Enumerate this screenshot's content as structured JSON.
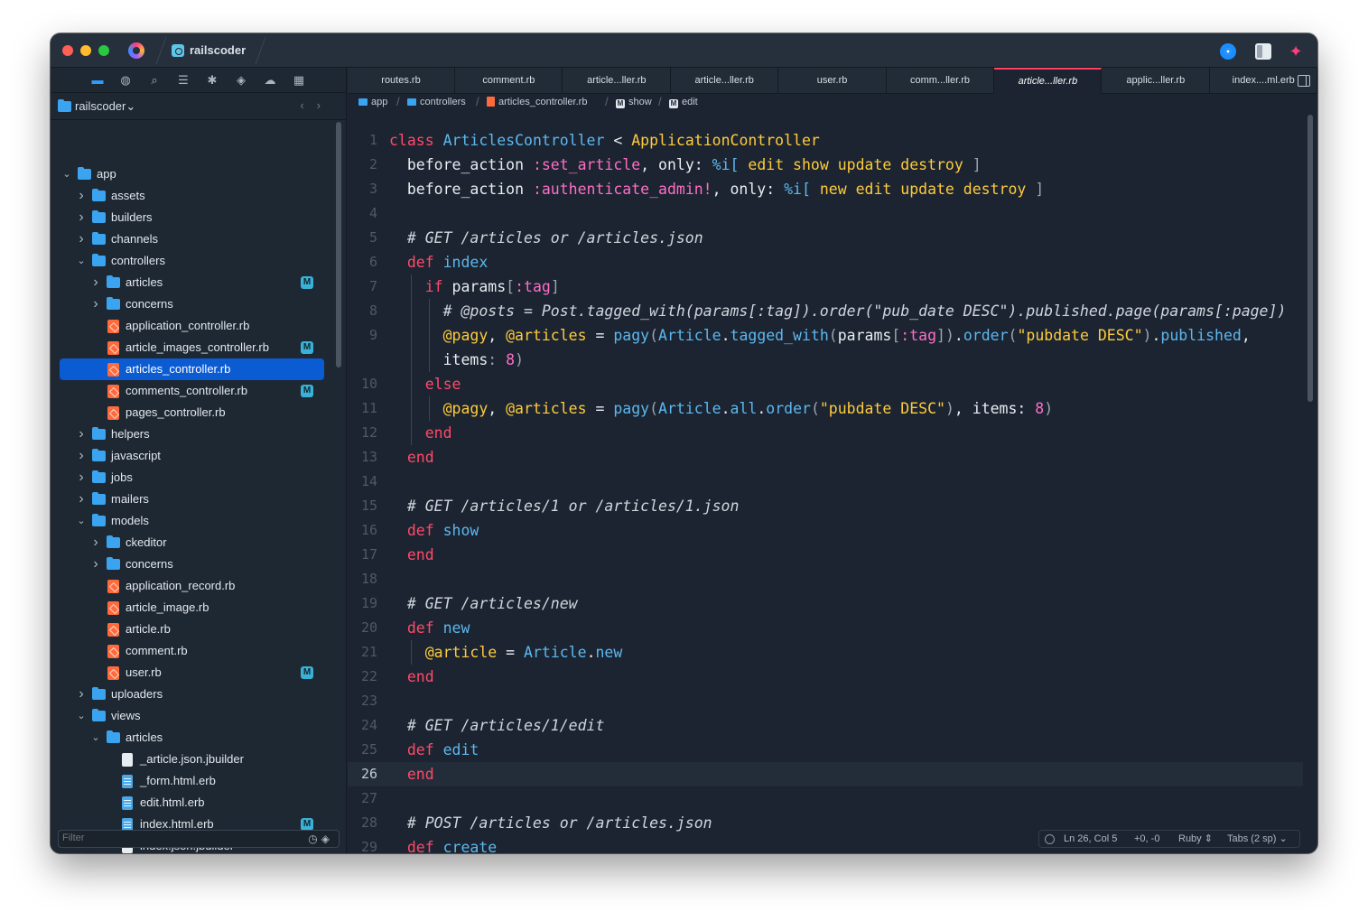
{
  "titlebar": {
    "project_name": "railscoder"
  },
  "sidebar": {
    "toolbar_icons": [
      "folder-icon",
      "globe-icon",
      "search-icon",
      "list-icon",
      "asterisk-icon",
      "git-icon",
      "cloud-icon",
      "grid-icon"
    ],
    "root_title": "railscoder",
    "filter_placeholder": "Filter",
    "tree": [
      {
        "label": "app",
        "type": "folder",
        "depth": 0,
        "expanded": true,
        "modified": false,
        "selected": false
      },
      {
        "label": "assets",
        "type": "folder",
        "depth": 1,
        "expanded": false,
        "modified": false,
        "selected": false
      },
      {
        "label": "builders",
        "type": "folder",
        "depth": 1,
        "expanded": false,
        "modified": false,
        "selected": false
      },
      {
        "label": "channels",
        "type": "folder",
        "depth": 1,
        "expanded": false,
        "modified": false,
        "selected": false
      },
      {
        "label": "controllers",
        "type": "folder",
        "depth": 1,
        "expanded": true,
        "modified": false,
        "selected": false
      },
      {
        "label": "articles",
        "type": "folder",
        "depth": 2,
        "expanded": false,
        "modified": true,
        "selected": false
      },
      {
        "label": "concerns",
        "type": "folder",
        "depth": 2,
        "expanded": false,
        "modified": false,
        "selected": false
      },
      {
        "label": "application_controller.rb",
        "type": "rb",
        "depth": 2,
        "modified": false,
        "selected": false
      },
      {
        "label": "article_images_controller.rb",
        "type": "rb",
        "depth": 2,
        "modified": true,
        "selected": false
      },
      {
        "label": "articles_controller.rb",
        "type": "rb",
        "depth": 2,
        "modified": false,
        "selected": true
      },
      {
        "label": "comments_controller.rb",
        "type": "rb",
        "depth": 2,
        "modified": true,
        "selected": false
      },
      {
        "label": "pages_controller.rb",
        "type": "rb",
        "depth": 2,
        "modified": false,
        "selected": false
      },
      {
        "label": "helpers",
        "type": "folder",
        "depth": 1,
        "expanded": false,
        "modified": false,
        "selected": false
      },
      {
        "label": "javascript",
        "type": "folder",
        "depth": 1,
        "expanded": false,
        "modified": false,
        "selected": false
      },
      {
        "label": "jobs",
        "type": "folder",
        "depth": 1,
        "expanded": false,
        "modified": false,
        "selected": false
      },
      {
        "label": "mailers",
        "type": "folder",
        "depth": 1,
        "expanded": false,
        "modified": false,
        "selected": false
      },
      {
        "label": "models",
        "type": "folder",
        "depth": 1,
        "expanded": true,
        "modified": false,
        "selected": false
      },
      {
        "label": "ckeditor",
        "type": "folder",
        "depth": 2,
        "expanded": false,
        "modified": false,
        "selected": false
      },
      {
        "label": "concerns",
        "type": "folder",
        "depth": 2,
        "expanded": false,
        "modified": false,
        "selected": false
      },
      {
        "label": "application_record.rb",
        "type": "rb",
        "depth": 2,
        "modified": false,
        "selected": false
      },
      {
        "label": "article_image.rb",
        "type": "rb",
        "depth": 2,
        "modified": false,
        "selected": false
      },
      {
        "label": "article.rb",
        "type": "rb",
        "depth": 2,
        "modified": false,
        "selected": false
      },
      {
        "label": "comment.rb",
        "type": "rb",
        "depth": 2,
        "modified": false,
        "selected": false
      },
      {
        "label": "user.rb",
        "type": "rb",
        "depth": 2,
        "modified": true,
        "selected": false
      },
      {
        "label": "uploaders",
        "type": "folder",
        "depth": 1,
        "expanded": false,
        "modified": false,
        "selected": false
      },
      {
        "label": "views",
        "type": "folder",
        "depth": 1,
        "expanded": true,
        "modified": false,
        "selected": false
      },
      {
        "label": "articles",
        "type": "folder",
        "depth": 2,
        "expanded": true,
        "modified": false,
        "selected": false
      },
      {
        "label": "_article.json.jbuilder",
        "type": "doc",
        "depth": 3,
        "modified": false,
        "selected": false
      },
      {
        "label": "_form.html.erb",
        "type": "erb",
        "depth": 3,
        "modified": false,
        "selected": false
      },
      {
        "label": "edit.html.erb",
        "type": "erb",
        "depth": 3,
        "modified": false,
        "selected": false
      },
      {
        "label": "index.html.erb",
        "type": "erb",
        "depth": 3,
        "modified": true,
        "selected": false
      },
      {
        "label": "index.json.jbuilder",
        "type": "doc",
        "depth": 3,
        "modified": false,
        "selected": false
      }
    ],
    "modified_badge": "M"
  },
  "tabs": [
    {
      "label": "routes.rb",
      "active": false
    },
    {
      "label": "comment.rb",
      "active": false
    },
    {
      "label": "article...ller.rb",
      "active": false
    },
    {
      "label": "article...ller.rb",
      "active": false
    },
    {
      "label": "user.rb",
      "active": false
    },
    {
      "label": "comm...ller.rb",
      "active": false
    },
    {
      "label": "article...ller.rb",
      "active": true
    },
    {
      "label": "applic...ller.rb",
      "active": false
    },
    {
      "label": "index....ml.erb",
      "active": false
    }
  ],
  "pathbar": [
    {
      "label": "app",
      "icon": "folder"
    },
    {
      "label": "controllers",
      "icon": "folder"
    },
    {
      "label": "articles_controller.rb",
      "icon": "rb"
    },
    {
      "label": "show",
      "icon": "method"
    },
    {
      "label": "edit",
      "icon": "method"
    }
  ],
  "editor": {
    "current_line": 26,
    "lines": [
      {
        "n": "1",
        "indent": 0,
        "t": [
          [
            "kw",
            "class"
          ],
          [
            "pl",
            " "
          ],
          [
            "cls",
            "ArticlesController"
          ],
          [
            "pl",
            " < "
          ],
          [
            "sup",
            "ApplicationController"
          ]
        ]
      },
      {
        "n": "2",
        "indent": 1,
        "t": [
          [
            "pl",
            "before_action "
          ],
          [
            "sym",
            ":set_article"
          ],
          [
            "pl",
            ", only: "
          ],
          [
            "pct",
            "%i["
          ],
          [
            "pl",
            " "
          ],
          [
            "wrd",
            "edit show update destroy"
          ],
          [
            "pl",
            " "
          ],
          [
            "dim",
            "]"
          ]
        ]
      },
      {
        "n": "3",
        "indent": 1,
        "t": [
          [
            "pl",
            "before_action "
          ],
          [
            "sym",
            ":authenticate_admin!"
          ],
          [
            "pl",
            ", only: "
          ],
          [
            "pct",
            "%i["
          ],
          [
            "pl",
            " "
          ],
          [
            "wrd",
            "new edit update destroy"
          ],
          [
            "pl",
            " "
          ],
          [
            "dim",
            "]"
          ]
        ]
      },
      {
        "n": "4",
        "indent": 0,
        "t": []
      },
      {
        "n": "5",
        "indent": 1,
        "t": [
          [
            "cmt",
            "# GET /articles or /articles.json"
          ]
        ]
      },
      {
        "n": "6",
        "indent": 1,
        "t": [
          [
            "kw",
            "def"
          ],
          [
            "pl",
            " "
          ],
          [
            "mth",
            "index"
          ]
        ]
      },
      {
        "n": "7",
        "indent": 2,
        "t": [
          [
            "kw",
            "if"
          ],
          [
            "pl",
            " params"
          ],
          [
            "dim",
            "["
          ],
          [
            "sym",
            ":tag"
          ],
          [
            "dim",
            "]"
          ]
        ]
      },
      {
        "n": "8",
        "indent": 3,
        "t": [
          [
            "cmt",
            "# @posts = Post.tagged_with(params[:tag]).order(\"pub_date DESC\").published.page(params[:page])"
          ]
        ]
      },
      {
        "n": "9",
        "indent": 3,
        "t": [
          [
            "ivar",
            "@pagy"
          ],
          [
            "pl",
            ", "
          ],
          [
            "ivar",
            "@articles"
          ],
          [
            "pl",
            " = "
          ],
          [
            "mth",
            "pagy"
          ],
          [
            "dim",
            "("
          ],
          [
            "cls",
            "Article"
          ],
          [
            "pl",
            "."
          ],
          [
            "mth",
            "tagged_with"
          ],
          [
            "dim",
            "("
          ],
          [
            "pl",
            "params"
          ],
          [
            "dim",
            "["
          ],
          [
            "sym",
            ":tag"
          ],
          [
            "dim",
            "])"
          ],
          [
            "pl",
            "."
          ],
          [
            "mth",
            "order"
          ],
          [
            "dim",
            "("
          ],
          [
            "str",
            "\"pubdate DESC\""
          ],
          [
            "dim",
            ")"
          ],
          [
            "pl",
            "."
          ],
          [
            "mth",
            "published"
          ],
          [
            "pl",
            ","
          ]
        ]
      },
      {
        "n": "",
        "indent": 3,
        "t": [
          [
            "pl",
            "items"
          ],
          [
            "dim",
            ": "
          ],
          [
            "num",
            "8"
          ],
          [
            "dim",
            ")"
          ]
        ]
      },
      {
        "n": "10",
        "indent": 2,
        "t": [
          [
            "kw",
            "else"
          ]
        ]
      },
      {
        "n": "11",
        "indent": 3,
        "t": [
          [
            "ivar",
            "@pagy"
          ],
          [
            "pl",
            ", "
          ],
          [
            "ivar",
            "@articles"
          ],
          [
            "pl",
            " = "
          ],
          [
            "mth",
            "pagy"
          ],
          [
            "dim",
            "("
          ],
          [
            "cls",
            "Article"
          ],
          [
            "pl",
            "."
          ],
          [
            "mth",
            "all"
          ],
          [
            "pl",
            "."
          ],
          [
            "mth",
            "order"
          ],
          [
            "dim",
            "("
          ],
          [
            "str",
            "\"pubdate DESC\""
          ],
          [
            "dim",
            ")"
          ],
          [
            "pl",
            ", items: "
          ],
          [
            "num",
            "8"
          ],
          [
            "dim",
            ")"
          ]
        ]
      },
      {
        "n": "12",
        "indent": 2,
        "t": [
          [
            "kw",
            "end"
          ]
        ]
      },
      {
        "n": "13",
        "indent": 1,
        "t": [
          [
            "kw",
            "end"
          ]
        ]
      },
      {
        "n": "14",
        "indent": 0,
        "t": []
      },
      {
        "n": "15",
        "indent": 1,
        "t": [
          [
            "cmt",
            "# GET /articles/1 or /articles/1.json"
          ]
        ]
      },
      {
        "n": "16",
        "indent": 1,
        "t": [
          [
            "kw",
            "def"
          ],
          [
            "pl",
            " "
          ],
          [
            "mth",
            "show"
          ]
        ]
      },
      {
        "n": "17",
        "indent": 1,
        "t": [
          [
            "kw",
            "end"
          ]
        ]
      },
      {
        "n": "18",
        "indent": 0,
        "t": []
      },
      {
        "n": "19",
        "indent": 1,
        "t": [
          [
            "cmt",
            "# GET /articles/new"
          ]
        ]
      },
      {
        "n": "20",
        "indent": 1,
        "t": [
          [
            "kw",
            "def"
          ],
          [
            "pl",
            " "
          ],
          [
            "mth",
            "new"
          ]
        ]
      },
      {
        "n": "21",
        "indent": 2,
        "t": [
          [
            "ivar",
            "@article"
          ],
          [
            "pl",
            " = "
          ],
          [
            "cls",
            "Article"
          ],
          [
            "pl",
            "."
          ],
          [
            "mth",
            "new"
          ]
        ]
      },
      {
        "n": "22",
        "indent": 1,
        "t": [
          [
            "kw",
            "end"
          ]
        ]
      },
      {
        "n": "23",
        "indent": 0,
        "t": []
      },
      {
        "n": "24",
        "indent": 1,
        "t": [
          [
            "cmt",
            "# GET /articles/1/edit"
          ]
        ]
      },
      {
        "n": "25",
        "indent": 1,
        "t": [
          [
            "kw",
            "def"
          ],
          [
            "pl",
            " "
          ],
          [
            "mth",
            "edit"
          ]
        ]
      },
      {
        "n": "26",
        "indent": 1,
        "t": [
          [
            "kw",
            "end"
          ]
        ]
      },
      {
        "n": "27",
        "indent": 0,
        "t": []
      },
      {
        "n": "28",
        "indent": 1,
        "t": [
          [
            "cmt",
            "# POST /articles or /articles.json"
          ]
        ]
      },
      {
        "n": "29",
        "indent": 1,
        "t": [
          [
            "kw",
            "def"
          ],
          [
            "pl",
            " "
          ],
          [
            "mth",
            "create"
          ]
        ]
      }
    ]
  },
  "statusbar": {
    "position": "Ln 26, Col 5",
    "diff": "+0, -0",
    "language": "Ruby",
    "indentation": "Tabs (2 sp)"
  },
  "colors": {
    "accent": "#0b5bd3",
    "active_tab_border": "#ff4266",
    "keyword": "#ff4a6a",
    "class": "#5cb8f0",
    "string": "#ffcb3d",
    "symbol": "#ff6ec7"
  }
}
